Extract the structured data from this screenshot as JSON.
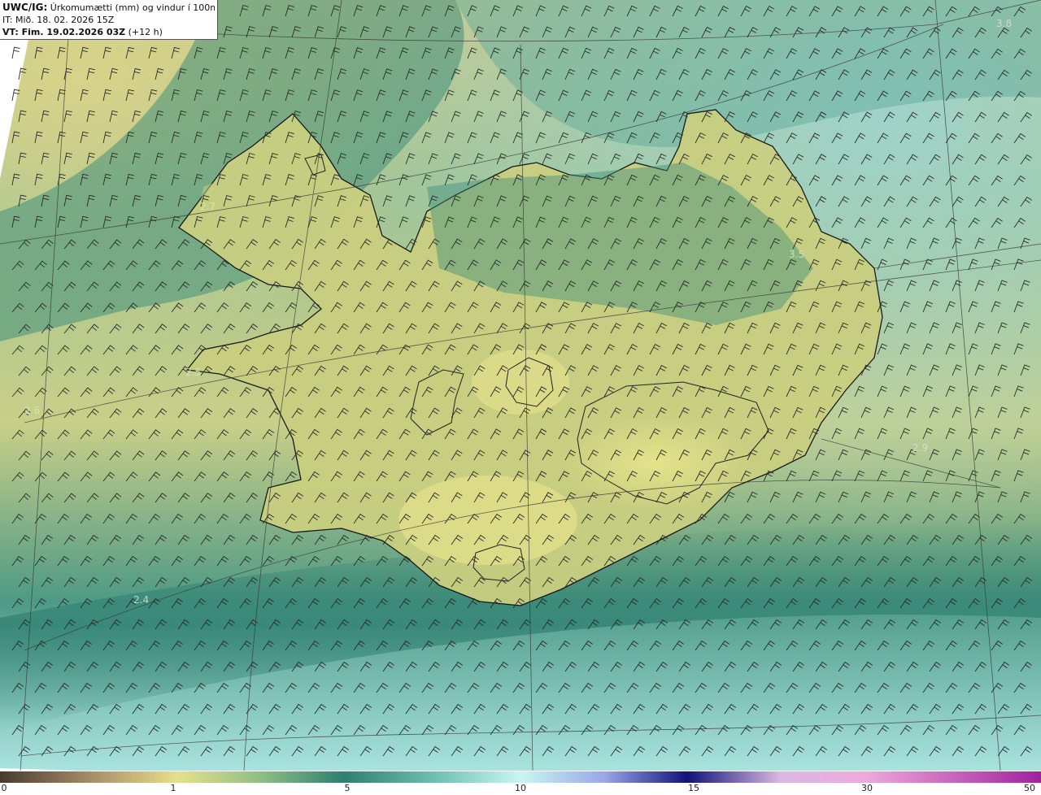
{
  "header": {
    "code": "UWC/IG:",
    "title": "Úrkomumætti (mm) og vindur í 100m hæð",
    "init_time": "IT: Mið. 18. 02. 2026 15Z",
    "valid_label": "VT: Fim. 19.02.2026 03Z",
    "valid_offset": "(+12 h)"
  },
  "map_labels": [
    {
      "id": "pw-1",
      "text": "2.7"
    },
    {
      "id": "pw-2",
      "text": "3.5"
    },
    {
      "id": "pw-3",
      "text": "2.6"
    },
    {
      "id": "pw-4",
      "text": "2.4"
    },
    {
      "id": "pw-5",
      "text": "2.9"
    },
    {
      "id": "pw-6",
      "text": "3.8"
    },
    {
      "id": "pw-7",
      "text": "2.5"
    }
  ],
  "legend": {
    "ticks": [
      "0",
      "1",
      "5",
      "10",
      "15",
      "30",
      "50"
    ],
    "colors": [
      "#5a4535",
      "#b09a6a",
      "#e6e08a",
      "#2f7f6f",
      "#6fbfaf",
      "#c8f4f0",
      "#1a1a8a",
      "#e9a8e0",
      "#b02aa8"
    ]
  },
  "colors": {
    "sea_green": "#4a9f8c",
    "land_yellow": "#d7d98a",
    "coast_line": "#111111",
    "wind_barb": "#2a2a2a"
  }
}
